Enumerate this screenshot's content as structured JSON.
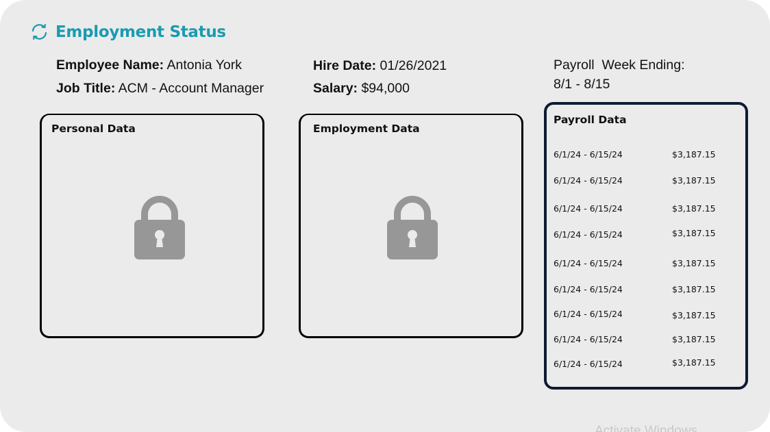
{
  "header": {
    "title": "Employment Status",
    "refresh_icon": "refresh-icon",
    "accent_color": "#1a9bb0"
  },
  "employee": {
    "name_label": "Employee Name:",
    "name_value": " Antonia York",
    "job_label": "Job Title:",
    "job_value": " ACM - Account Manager",
    "hire_label": "Hire Date:",
    "hire_value": " 01/26/2021",
    "salary_label": "Salary:",
    "salary_value": " $94,000",
    "payroll_week_label": "Payroll  Week Ending:",
    "payroll_week_value": "8/1 - 8/15"
  },
  "panels": {
    "personal": {
      "title": "Personal Data",
      "icon": "lock-icon"
    },
    "employment": {
      "title": "Employment Data",
      "icon": "lock-icon"
    },
    "payroll": {
      "title": "Payroll Data",
      "rows": [
        {
          "period": "6/1/24 - 6/15/24",
          "amount": "$3,187.15"
        },
        {
          "period": "6/1/24 - 6/15/24",
          "amount": "$3,187.15"
        },
        {
          "period": "6/1/24 - 6/15/24",
          "amount": "$3,187.15"
        },
        {
          "period": "6/1/24 - 6/15/24",
          "amount": "$3,187.15"
        },
        {
          "period": "6/1/24 - 6/15/24",
          "amount": "$3,187.15"
        },
        {
          "period": "6/1/24 - 6/15/24",
          "amount": "$3,187.15"
        },
        {
          "period": "6/1/24 - 6/15/24",
          "amount": "$3,187.15"
        },
        {
          "period": "6/1/24 - 6/15/24",
          "amount": "$3,187.15"
        },
        {
          "period": "6/1/24 - 6/15/24",
          "amount": "$3,187.15"
        }
      ]
    }
  },
  "watermark": "Activate Windows"
}
